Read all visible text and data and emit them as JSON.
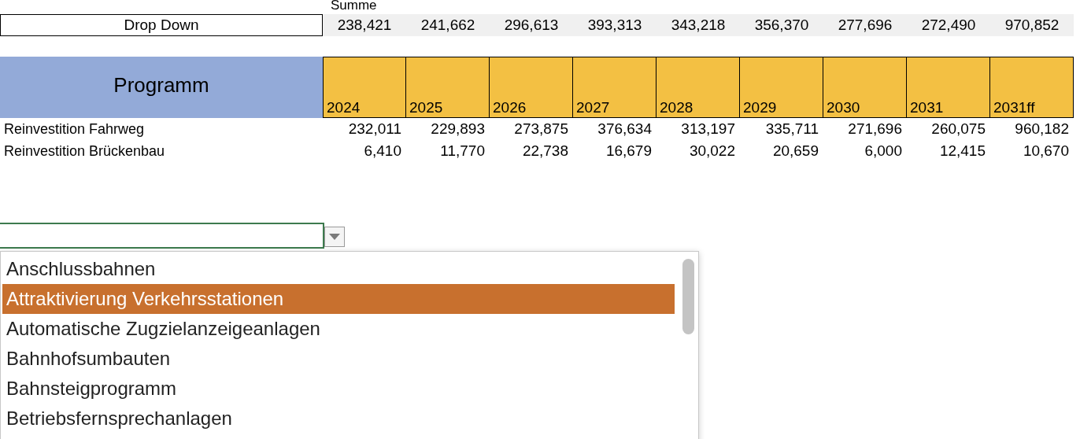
{
  "summary": {
    "label": "Summe",
    "name_cell": "Drop Down",
    "values": [
      "238,421",
      "241,662",
      "296,613",
      "393,313",
      "343,218",
      "356,370",
      "277,696",
      "272,490",
      "970,852"
    ]
  },
  "table": {
    "header": "Programm",
    "columns": [
      "2024",
      "2025",
      "2026",
      "2027",
      "2028",
      "2029",
      "2030",
      "2031",
      "2031ff"
    ],
    "rows": [
      {
        "name": "Reinvestition Fahrweg",
        "values": [
          "232,011",
          "229,893",
          "273,875",
          "376,634",
          "313,197",
          "335,711",
          "271,696",
          "260,075",
          "960,182"
        ]
      },
      {
        "name": "Reinvestition Brückenbau",
        "values": [
          "6,410",
          "11,770",
          "22,738",
          "16,679",
          "30,022",
          "20,659",
          "6,000",
          "12,415",
          "10,670"
        ]
      }
    ]
  },
  "dropdown": {
    "options": [
      {
        "label": "Anschlussbahnen",
        "selected": false
      },
      {
        "label": "Attraktivierung Verkehrsstationen",
        "selected": true
      },
      {
        "label": "Automatische Zugzielanzeigeanlagen",
        "selected": false
      },
      {
        "label": "Bahnhofsumbauten",
        "selected": false
      },
      {
        "label": "Bahnsteigprogramm",
        "selected": false
      },
      {
        "label": "Betriebsfernsprechanlagen",
        "selected": false
      }
    ]
  }
}
